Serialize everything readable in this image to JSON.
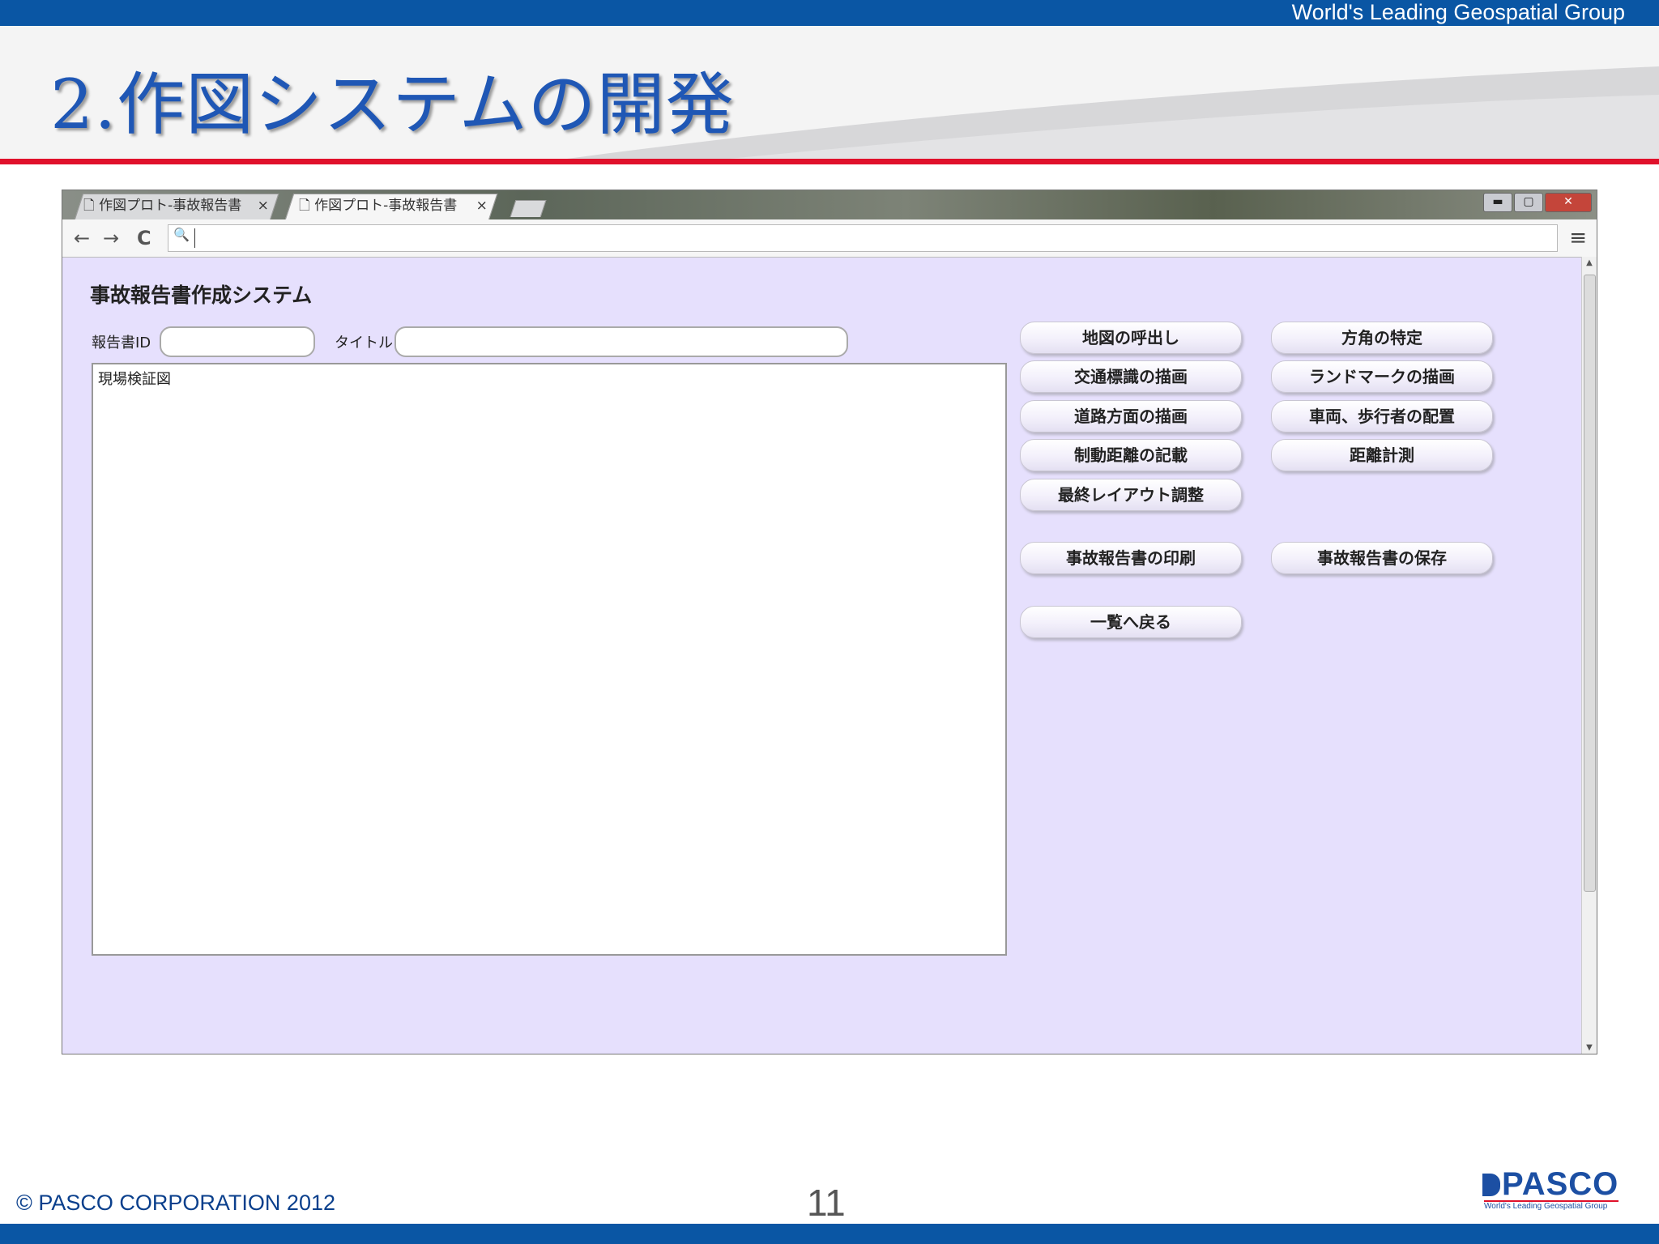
{
  "header": {
    "tagline": "World's Leading Geospatial Group",
    "slide_title": "2.作図システムの開発"
  },
  "browser": {
    "tabs": [
      {
        "label": "作図プロト-事故報告書",
        "close": "×"
      },
      {
        "label": "作図プロト-事故報告書",
        "close": "×"
      }
    ],
    "window_buttons": {
      "minimize": "▬",
      "maximize": "▢",
      "close": "✕"
    },
    "nav": {
      "back": "←",
      "forward": "→",
      "reload": "C",
      "search": "🔍",
      "menu": "≡"
    },
    "address_value": ""
  },
  "app": {
    "title": "事故報告書作成システム",
    "report_id_label": "報告書ID",
    "report_id_value": "",
    "title_label": "タイトル",
    "title_value": "",
    "canvas_label": "現場検証図",
    "buttons": {
      "call_map": "地図の呼出し",
      "set_direction": "方角の特定",
      "draw_traffic_signs": "交通標識の描画",
      "draw_landmarks": "ランドマークの描画",
      "draw_road_direction": "道路方面の描画",
      "place_vehicles": "車両、歩行者の配置",
      "record_braking": "制動距離の記載",
      "measure_distance": "距離計測",
      "final_layout": "最終レイアウト調整",
      "print_report": "事故報告書の印刷",
      "save_report": "事故報告書の保存",
      "back_to_list": "一覧へ戻る"
    }
  },
  "footer": {
    "copyright": "© PASCO CORPORATION 2012",
    "page_number": "11",
    "logo_text": "PASCO",
    "logo_sub": "World's Leading Geospatial Group"
  }
}
